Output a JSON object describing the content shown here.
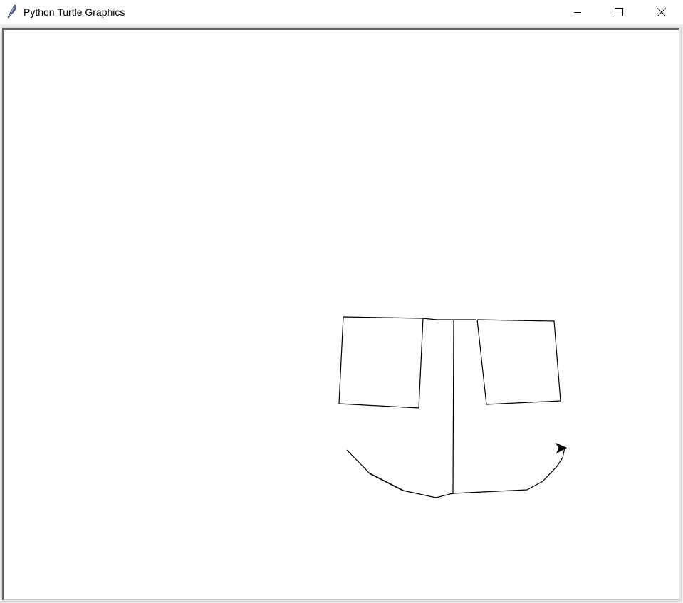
{
  "window": {
    "title": "Python Turtle Graphics",
    "app_icon": "feather-icon",
    "controls": {
      "minimize_icon": "minimize-icon",
      "maximize_icon": "maximize-icon",
      "close_icon": "close-icon"
    }
  },
  "canvas": {
    "background": "#ffffff",
    "pen_color": "#000000",
    "turtle_shape": "classic-arrow"
  }
}
